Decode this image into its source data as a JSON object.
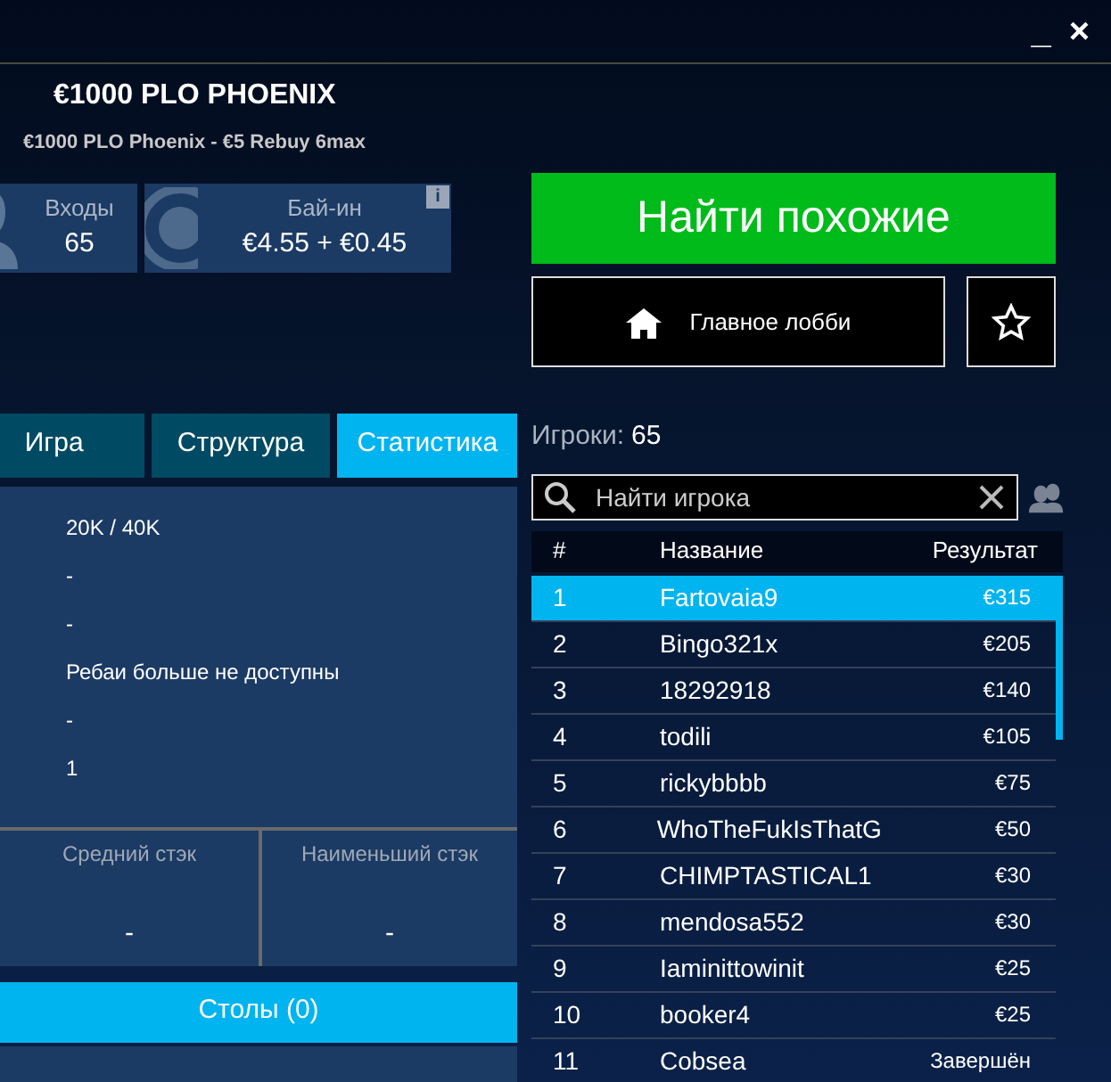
{
  "window": {
    "controls": [
      "_",
      "×"
    ]
  },
  "tournament": {
    "title": "€1000 PLO PHOENIX",
    "subtitle": "€1000 PLO Phoenix - €5 Rebuy 6max"
  },
  "tiles": [
    {
      "kind": "player",
      "label": "Входы",
      "value": "65"
    },
    {
      "kind": "chip",
      "label": "Бай-ин",
      "value": "€4.55 + €0.45",
      "info": "i"
    }
  ],
  "tabs": [
    {
      "label": "Игра",
      "selected": false
    },
    {
      "label": "Структура",
      "selected": false
    },
    {
      "label": "Статистика",
      "selected": true
    }
  ],
  "stats": [
    "20K / 40K",
    "-",
    "-",
    "Ребаи больше не доступны",
    "-",
    "1"
  ],
  "stacks": [
    {
      "label": "Средний стэк",
      "value": "-"
    },
    {
      "label": "Наименьший стэк",
      "value": "-"
    }
  ],
  "tables_button": "Столы (0)",
  "find_similar": "Найти похожие",
  "main_lobby": "Главное лобби",
  "players": {
    "label": "Игроки:",
    "count": "65"
  },
  "search": {
    "placeholder": "Найти игрока"
  },
  "table": {
    "columns": [
      "#",
      "Название",
      "Результат"
    ],
    "rows": [
      {
        "rank": "1",
        "name": "Fartovaia9",
        "result": "€315",
        "selected": true
      },
      {
        "rank": "2",
        "name": "Bingo321x",
        "result": "€205",
        "selected": false
      },
      {
        "rank": "3",
        "name": "18292918",
        "result": "€140",
        "selected": false
      },
      {
        "rank": "4",
        "name": "todili",
        "result": "€105",
        "selected": false
      },
      {
        "rank": "5",
        "name": "rickybbbb",
        "result": "€75",
        "selected": false
      },
      {
        "rank": "6",
        "name": "WhoTheFukIsThatG",
        "result": "€50",
        "selected": false
      },
      {
        "rank": "7",
        "name": "CHIMPTASTICAL1",
        "result": "€30",
        "selected": false
      },
      {
        "rank": "8",
        "name": "mendosa552",
        "result": "€30",
        "selected": false
      },
      {
        "rank": "9",
        "name": "Iaminittowinit",
        "result": "€25",
        "selected": false
      },
      {
        "rank": "10",
        "name": "booker4",
        "result": "€25",
        "selected": false
      },
      {
        "rank": "11",
        "name": "Cobsea",
        "result": "Завершён",
        "selected": false
      }
    ]
  }
}
